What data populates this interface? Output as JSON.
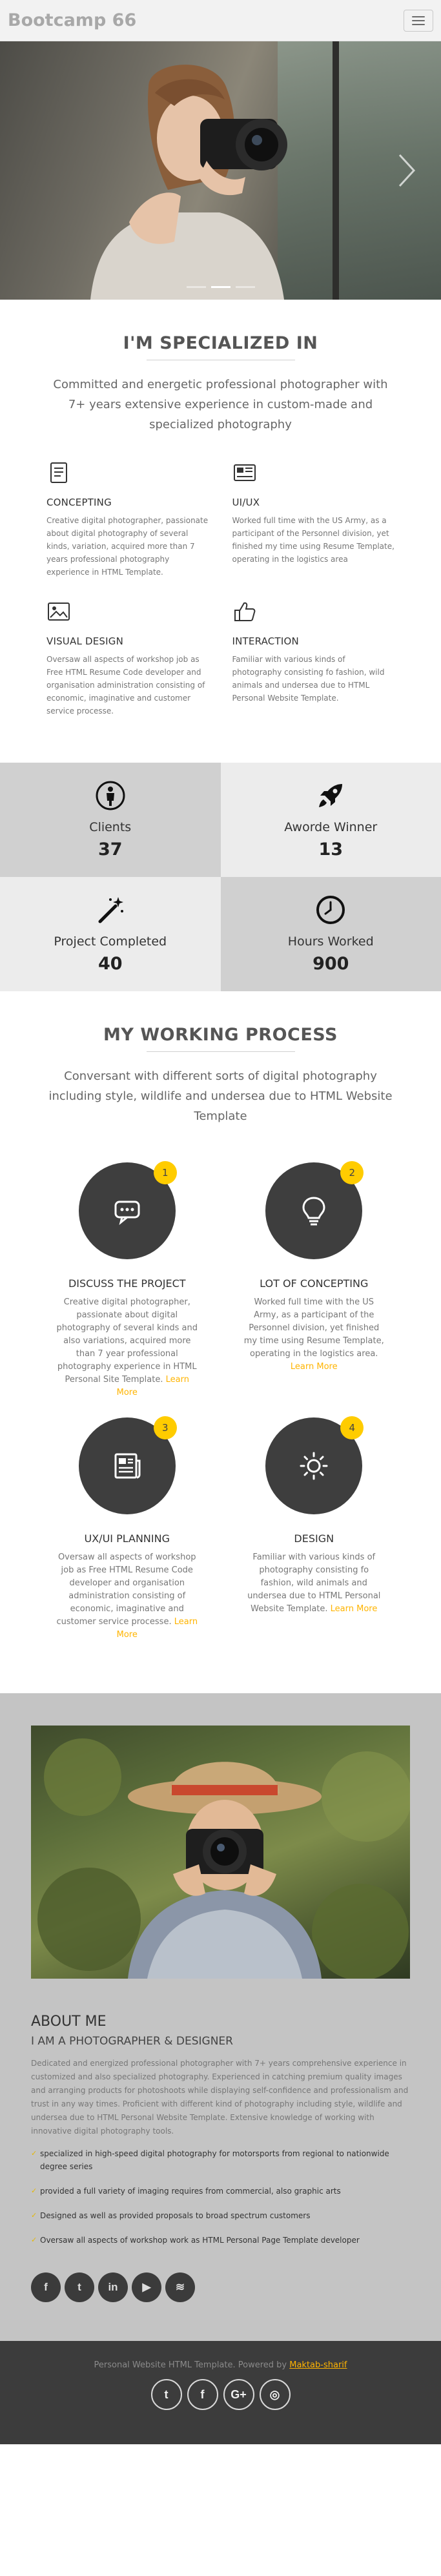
{
  "navbar": {
    "brand": "Bootcamp 66",
    "menu_icon": "hamburger-icon"
  },
  "hero": {
    "slide_count": 3,
    "active_slide": 1,
    "next_icon": "chevron-right-icon"
  },
  "specialized": {
    "title": "I'M SPECIALIZED IN",
    "lead": "Committed and energetic professional photographer with 7+ years extensive experience in custom-made and specialized photography",
    "features": [
      {
        "icon": "document-icon",
        "title": "CONCEPTING",
        "text": "Creative digital photographer, passionate about digital photography of several kinds, variation, acquired more than 7 years professional photography experience in HTML Template."
      },
      {
        "icon": "layout-icon",
        "title": "UI/UX",
        "text": "Worked full time with the US Army, as a participant of the Personnel division, yet finished my time using Resume Template, operating in the logistics area"
      },
      {
        "icon": "image-icon",
        "title": "VISUAL DESIGN",
        "text": "Oversaw all aspects of workshop job as Free HTML Resume Code developer and organisation administration consisting of economic, imaginative and customer service processe."
      },
      {
        "icon": "thumbs-up-icon",
        "title": "INTERACTION",
        "text": "Familiar with various kinds of photography consisting fo fashion, wild animals and undersea due to HTML Personal Website Template."
      }
    ]
  },
  "stats": [
    {
      "icon": "person-icon",
      "label": "Clients",
      "value": "37"
    },
    {
      "icon": "rocket-icon",
      "label": "Aworde Winner",
      "value": "13"
    },
    {
      "icon": "magic-wand-icon",
      "label": "Project Completed",
      "value": "40"
    },
    {
      "icon": "clock-icon",
      "label": "Hours Worked",
      "value": "900"
    }
  ],
  "process": {
    "title": "MY WORKING PROCESS",
    "lead": "Conversant with different sorts of digital photography including style, wildlife and undersea due to HTML Website Template",
    "learn_more": "Learn More",
    "steps": [
      {
        "number": "1",
        "icon": "chat-icon",
        "title": "DISCUSS THE PROJECT",
        "text": "Creative digital photographer, passionate about digital photography of several kinds and also variations, acquired more than 7 year professional photography experience in HTML Personal Site Template."
      },
      {
        "number": "2",
        "icon": "lightbulb-icon",
        "title": "LOT OF CONCEPTING",
        "text": "Worked full time with the US Army, as a participant of the Personnel division, yet finished my time using Resume Template, operating in the logistics area."
      },
      {
        "number": "3",
        "icon": "newspaper-icon",
        "title": "UX/UI PLANNING",
        "text": "Oversaw all aspects of workshop job as Free HTML Resume Code developer and organisation administration consisting of economic, imaginative and customer service processe."
      },
      {
        "number": "4",
        "icon": "sun-icon",
        "title": "DESIGN",
        "text": "Familiar with various kinds of photography consisting fo fashion, wild animals and undersea due to HTML Personal Website Template."
      }
    ]
  },
  "about": {
    "heading": "ABOUT ME",
    "subheading": "I AM A PHOTOGRAPHER & DESIGNER",
    "paragraph": "Dedicated and energized professional photographer with 7+ years comprehensive experience in customized and also specialized photography. Experienced in catching premium quality images and arranging products for photoshoots while displaying self-confidence and professionalism and trust in any way times. Proficient with different kind of photography including style, wildlife and undersea due to HTML Personal Website Template. Extensive knowledge of working with innovative digital photography tools.",
    "bullets": [
      "specialized in high-speed digital photography for motorsports from regional to nationwide degree series",
      "provided a full variety of imaging requires from commercial, also graphic arts",
      "Designed as well as provided proposals to broad spectrum customers",
      "Oversaw all aspects of workshop work as HTML Personal Page Template developer"
    ],
    "socials": [
      {
        "icon": "facebook-icon",
        "glyph": "f"
      },
      {
        "icon": "twitter-icon",
        "glyph": "t"
      },
      {
        "icon": "linkedin-icon",
        "glyph": "in"
      },
      {
        "icon": "youtube-icon",
        "glyph": "▶"
      },
      {
        "icon": "spotify-icon",
        "glyph": "≋"
      }
    ]
  },
  "footer": {
    "credit_prefix": "Personal Website HTML Template. Powered by",
    "credit_link": "Maktab-sharif",
    "socials": [
      {
        "icon": "twitter-icon",
        "glyph": "t"
      },
      {
        "icon": "facebook-icon",
        "glyph": "f"
      },
      {
        "icon": "google-plus-icon",
        "glyph": "G+"
      },
      {
        "icon": "instagram-icon",
        "glyph": "◎"
      }
    ]
  },
  "colors": {
    "accent": "#ffcc00",
    "link": "#ffb400",
    "dark_circle": "#3e3e3e",
    "footer": "#3c3c3c",
    "about_bg": "#c4c4c4"
  }
}
